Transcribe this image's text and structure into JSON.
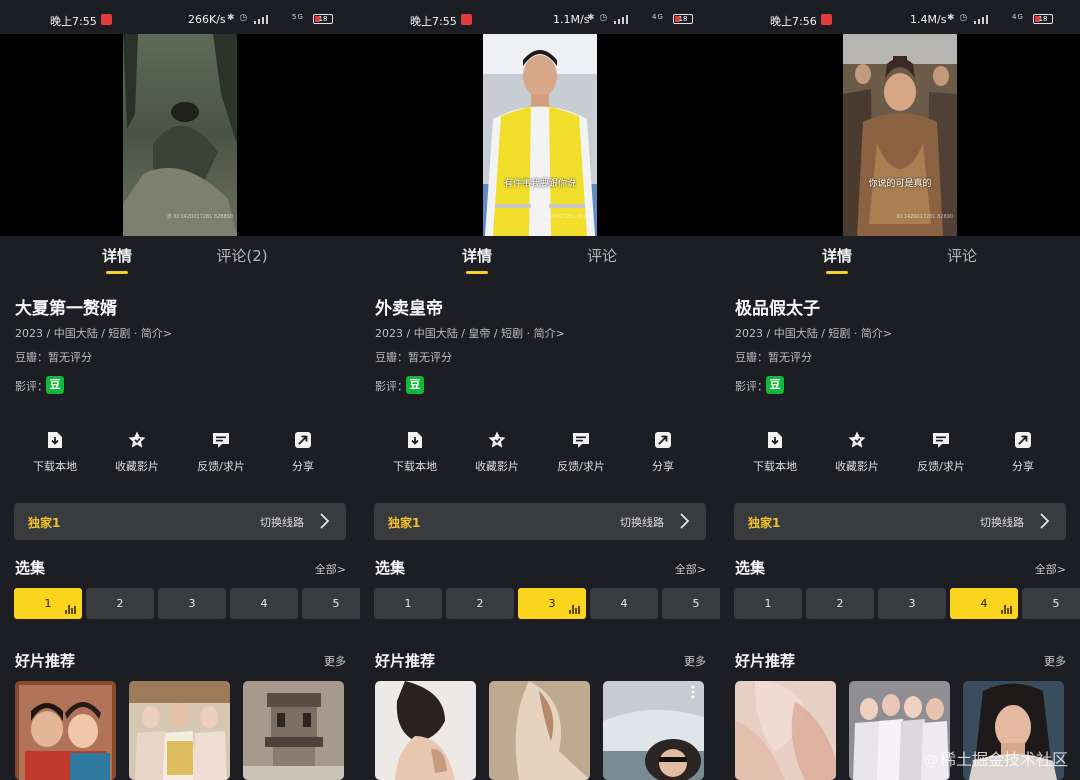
{
  "screens": [
    {
      "status": {
        "time": "晚上7:55",
        "net": "266K/s",
        "battery": "18",
        "net_type": "5G"
      },
      "video": {
        "subtitle": "",
        "watermark": "赤 ID:1420017281 828890"
      },
      "tabs": [
        "详情",
        "评论(2)"
      ],
      "title": "大夏第一赘婿",
      "meta": "2023 / 中国大陆 / 短剧 · 简介>",
      "douban": "豆瓣：暂无评分",
      "review_label": "影评：",
      "douban_icon": "豆",
      "actions": [
        "下载本地",
        "收藏影片",
        "反馈/求片",
        "分享"
      ],
      "route": {
        "name": "独家1",
        "switch": "切换线路"
      },
      "episodes_title": "选集",
      "episodes_more": "全部>",
      "episodes": [
        "1",
        "2",
        "3",
        "4",
        "5"
      ],
      "active_episode": 0,
      "recs_title": "好片推荐",
      "recs_more": "更多"
    },
    {
      "status": {
        "time": "晚上7:55",
        "net": "1.1M/s",
        "battery": "18",
        "net_type": "4G"
      },
      "video": {
        "subtitle": "有件事我要跟你说",
        "watermark": "ID:1420017281 82890"
      },
      "tabs": [
        "详情",
        "评论"
      ],
      "title": "外卖皇帝",
      "meta": "2023 / 中国大陆 / 皇帝 / 短剧 · 简介>",
      "douban": "豆瓣：暂无评分",
      "review_label": "影评：",
      "douban_icon": "豆",
      "actions": [
        "下载本地",
        "收藏影片",
        "反馈/求片",
        "分享"
      ],
      "route": {
        "name": "独家1",
        "switch": "切换线路"
      },
      "episodes_title": "选集",
      "episodes_more": "全部>",
      "episodes": [
        "1",
        "2",
        "3",
        "4",
        "5"
      ],
      "active_episode": 2,
      "recs_title": "好片推荐",
      "recs_more": "更多"
    },
    {
      "status": {
        "time": "晚上7:56",
        "net": "1.4M/s",
        "battery": "18",
        "net_type": "4G"
      },
      "video": {
        "subtitle": "你说的可是真的",
        "watermark": "ID:1420017281 82890"
      },
      "tabs": [
        "详情",
        "评论"
      ],
      "title": "极品假太子",
      "meta": "2023 / 中国大陆 / 短剧 · 简介>",
      "douban": "豆瓣：暂无评分",
      "review_label": "影评：",
      "douban_icon": "豆",
      "actions": [
        "下载本地",
        "收藏影片",
        "反馈/求片",
        "分享"
      ],
      "route": {
        "name": "独家1",
        "switch": "切换线路"
      },
      "episodes_title": "选集",
      "episodes_more": "全部>",
      "episodes": [
        "1",
        "2",
        "3",
        "4",
        "5"
      ],
      "active_episode": 3,
      "recs_title": "好片推荐",
      "recs_more": "更多"
    }
  ],
  "watermark": "稀土掘金技术社区",
  "colors": {
    "accent": "#fbd41d",
    "route_name": "#f1c22c",
    "douban": "#12b83a",
    "bg": "#1d1e23",
    "card": "#3a3b3f"
  }
}
